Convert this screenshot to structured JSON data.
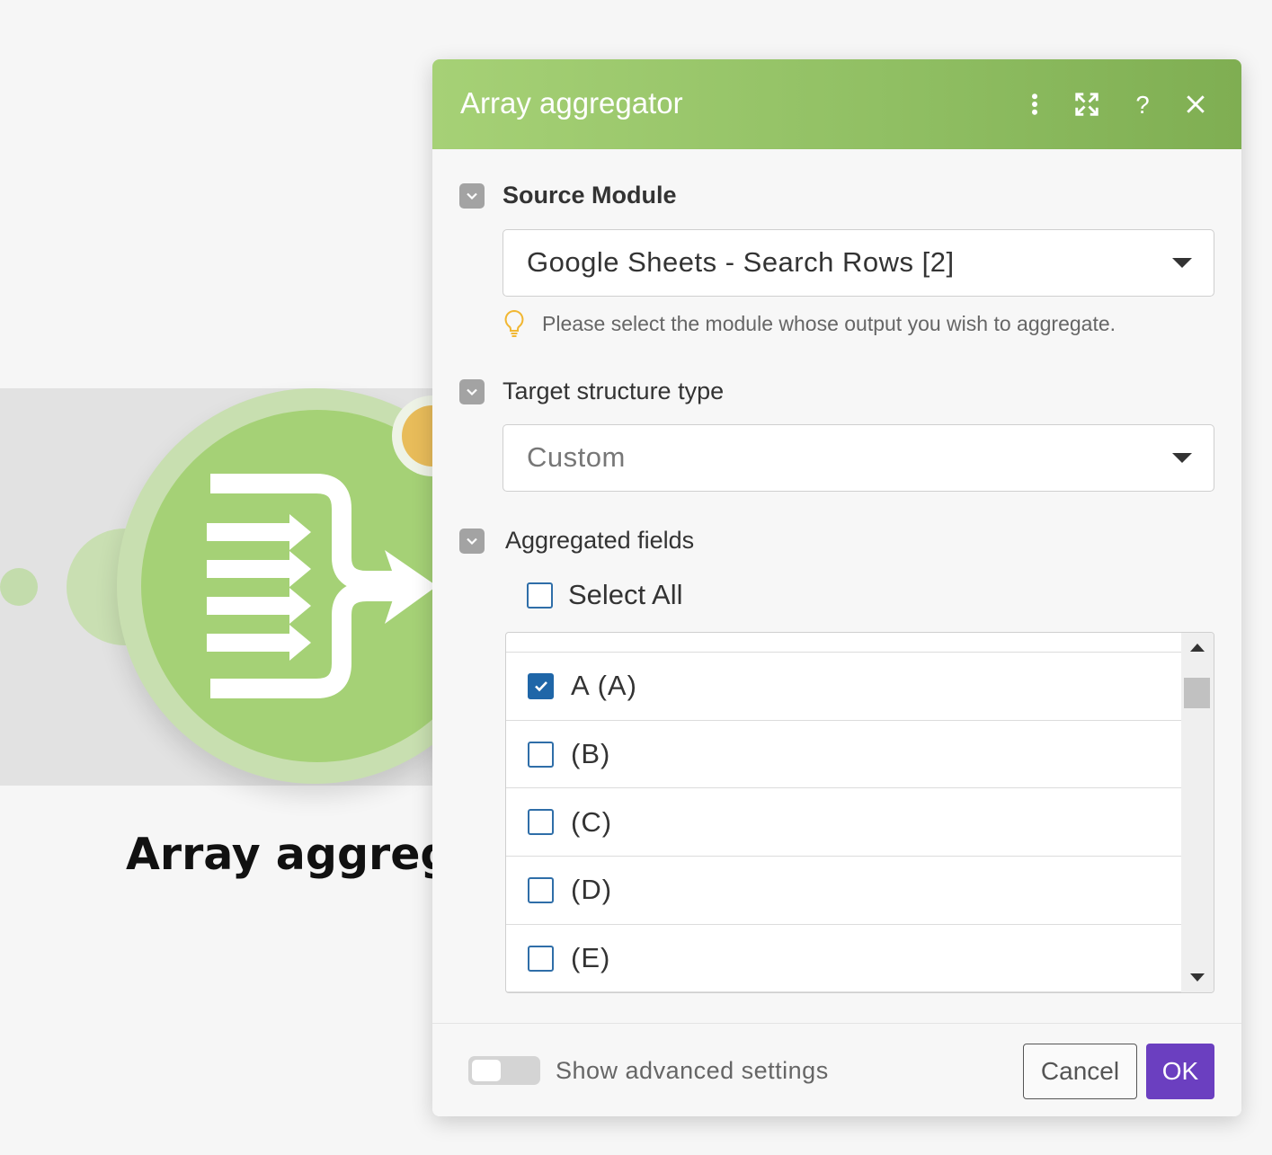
{
  "canvas": {
    "module_label": "Array aggregator"
  },
  "dialog": {
    "title": "Array aggregator",
    "header_icons": [
      "more-vertical-icon",
      "expand-icon",
      "help-icon",
      "close-icon"
    ],
    "source_module": {
      "label": "Source Module",
      "value": "Google Sheets - Search Rows [2]",
      "hint": "Please select the module whose output you wish to aggregate."
    },
    "target_structure": {
      "label": "Target structure type",
      "value": "Custom"
    },
    "aggregated_fields": {
      "label": "Aggregated fields",
      "select_all_label": "Select All",
      "select_all_checked": false,
      "items": [
        {
          "label": "A (A)",
          "checked": true
        },
        {
          "label": "(B)",
          "checked": false
        },
        {
          "label": "(C)",
          "checked": false
        },
        {
          "label": "(D)",
          "checked": false
        },
        {
          "label": "(E)",
          "checked": false
        }
      ]
    },
    "footer": {
      "advanced_toggle_label": "Show advanced settings",
      "advanced_enabled": false,
      "cancel_label": "Cancel",
      "ok_label": "OK"
    }
  },
  "colors": {
    "header_green": "#a6d176",
    "module_green": "#a5d176",
    "checkbox_blue": "#1f66a8",
    "ok_purple": "#6b3fc0",
    "badge_orange": "#e8bc5a"
  }
}
